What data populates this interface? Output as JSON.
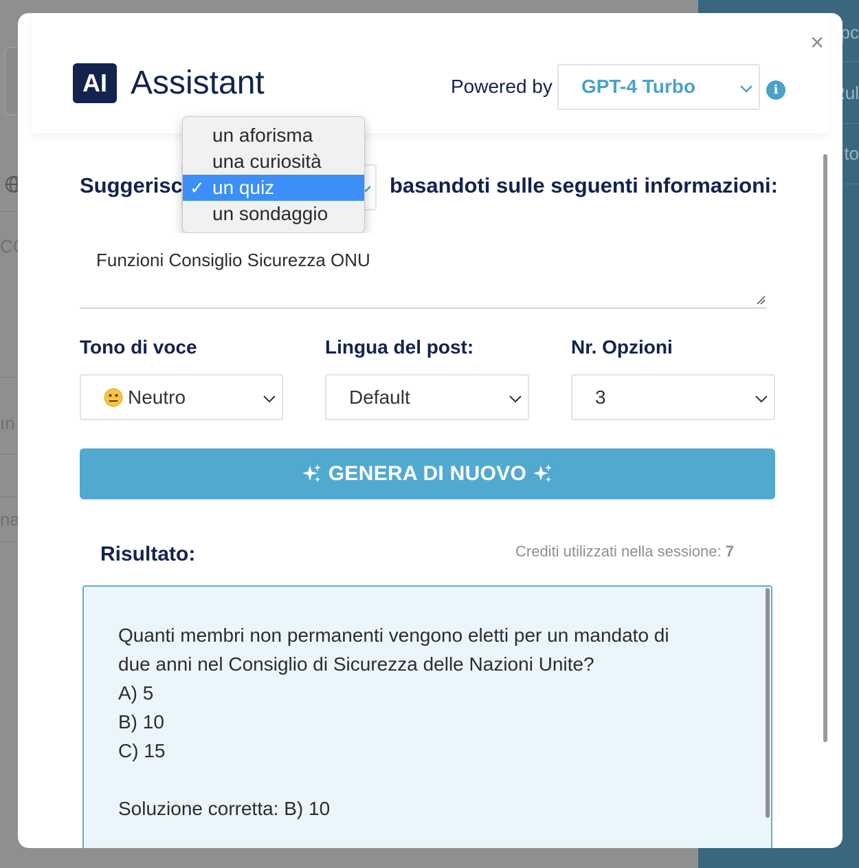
{
  "background": {
    "right_rows": [
      "pc",
      "Rul",
      "to"
    ],
    "left_fragments": [
      "CC",
      "ın",
      "nag"
    ]
  },
  "header": {
    "badge": "AI",
    "title": "Assistant",
    "powered_by_label": "Powered by",
    "model_value": "GPT-4 Turbo",
    "info_icon": "i"
  },
  "prompt": {
    "suggest_label": "Suggerisci",
    "after_label": "basandoti sulle seguenti informazioni:",
    "type_options": [
      "un aforisma",
      "una curiosità",
      "un quiz",
      "un sondaggio"
    ],
    "type_selected": "un quiz",
    "check_mark": "✓",
    "info_text": "Funzioni Consiglio Sicurezza ONU"
  },
  "options": {
    "tone_label": "Tono di voce",
    "tone_value": "Neutro",
    "language_label": "Lingua del post:",
    "language_value": "Default",
    "count_label": "Nr. Opzioni",
    "count_value": "3"
  },
  "generate_button": {
    "label": "GENERA DI NUOVO"
  },
  "result": {
    "title": "Risultato:",
    "credits_label": "Crediti utilizzati nella sessione:",
    "credits_value": "7",
    "lines": [
      "Quanti membri non permanenti vengono eletti per un mandato di",
      "due anni nel Consiglio di Sicurezza delle Nazioni Unite?",
      "A) 5",
      "B) 10",
      "C) 15",
      "",
      "Soluzione corretta: B) 10"
    ]
  },
  "close_icon": "×",
  "colors": {
    "navy": "#13234e",
    "accent": "#52a9d0",
    "model_text": "#4aa1ca",
    "menu_highlight": "#3b8ff6",
    "result_bg": "#ebf6fc"
  }
}
